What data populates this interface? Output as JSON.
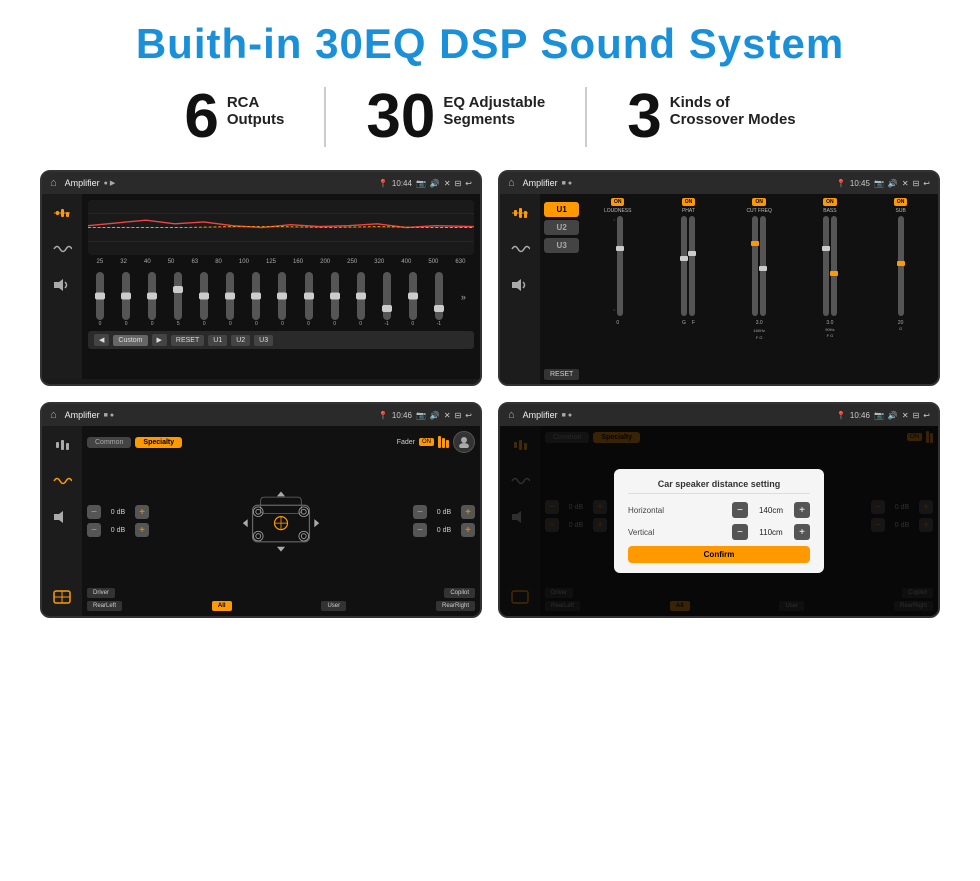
{
  "title": "Buith-in 30EQ DSP Sound System",
  "stats": [
    {
      "number": "6",
      "label_line1": "RCA",
      "label_line2": "Outputs"
    },
    {
      "number": "30",
      "label_line1": "EQ Adjustable",
      "label_line2": "Segments"
    },
    {
      "number": "3",
      "label_line1": "Kinds of",
      "label_line2": "Crossover Modes"
    }
  ],
  "screens": [
    {
      "id": "screen1",
      "status_bar": {
        "app": "Amplifier",
        "time": "10:44",
        "icons": [
          "▶",
          "📷",
          "🔊",
          "✕",
          "⊟",
          "↩"
        ]
      }
    },
    {
      "id": "screen2",
      "status_bar": {
        "app": "Amplifier",
        "time": "10:45"
      }
    },
    {
      "id": "screen3",
      "status_bar": {
        "app": "Amplifier",
        "time": "10:46"
      }
    },
    {
      "id": "screen4",
      "status_bar": {
        "app": "Amplifier",
        "time": "10:46"
      },
      "dialog": {
        "title": "Car speaker distance setting",
        "horizontal_label": "Horizontal",
        "horizontal_value": "140cm",
        "vertical_label": "Vertical",
        "vertical_value": "110cm",
        "confirm_label": "Confirm"
      }
    }
  ],
  "eq_freq_labels": [
    "25",
    "32",
    "40",
    "50",
    "63",
    "80",
    "100",
    "125",
    "160",
    "200",
    "250",
    "320",
    "400",
    "500",
    "630"
  ],
  "eq_vals": [
    "0",
    "0",
    "0",
    "5",
    "0",
    "0",
    "0",
    "0",
    "0",
    "0",
    "0",
    "-1",
    "0",
    "-1"
  ],
  "eq_controls": [
    "◀",
    "Custom",
    "▶",
    "RESET",
    "U1",
    "U2",
    "U3"
  ],
  "amp2_channels": [
    "LOUDNESS",
    "PHAT",
    "CUT FREQ",
    "BASS",
    "SUB"
  ],
  "fader_tabs": [
    "Common",
    "Specialty"
  ],
  "fader_bottom_btns": [
    "Driver",
    "",
    "Copilot",
    "RearLeft",
    "All",
    "User",
    "RearRight"
  ],
  "vol_labels": [
    "0 dB",
    "0 dB",
    "0 dB",
    "0 dB"
  ]
}
